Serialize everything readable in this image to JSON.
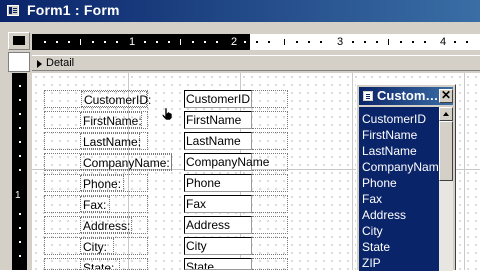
{
  "window": {
    "title": "Form1 : Form"
  },
  "ruler": {
    "marks": [
      "1",
      "2",
      "3",
      "4"
    ]
  },
  "vruler": {
    "marks": [
      "1"
    ]
  },
  "section": {
    "label": "Detail"
  },
  "controls": [
    {
      "label": "CustomerID:",
      "field": "CustomerID"
    },
    {
      "label": "FirstName:",
      "field": "FirstName"
    },
    {
      "label": "LastName:",
      "field": "LastName"
    },
    {
      "label": "CompanyName:",
      "field": "CompanyName"
    },
    {
      "label": "Phone:",
      "field": "Phone"
    },
    {
      "label": "Fax:",
      "field": "Fax"
    },
    {
      "label": "Address:",
      "field": "Address"
    },
    {
      "label": "City:",
      "field": "City"
    },
    {
      "label": "State:",
      "field": "State"
    }
  ],
  "field_list": {
    "title": "Custom…",
    "close": "✕",
    "items": [
      "CustomerID",
      "FirstName",
      "LastName",
      "CompanyName",
      "Phone",
      "Fax",
      "Address",
      "City",
      "State",
      "ZIP"
    ]
  }
}
